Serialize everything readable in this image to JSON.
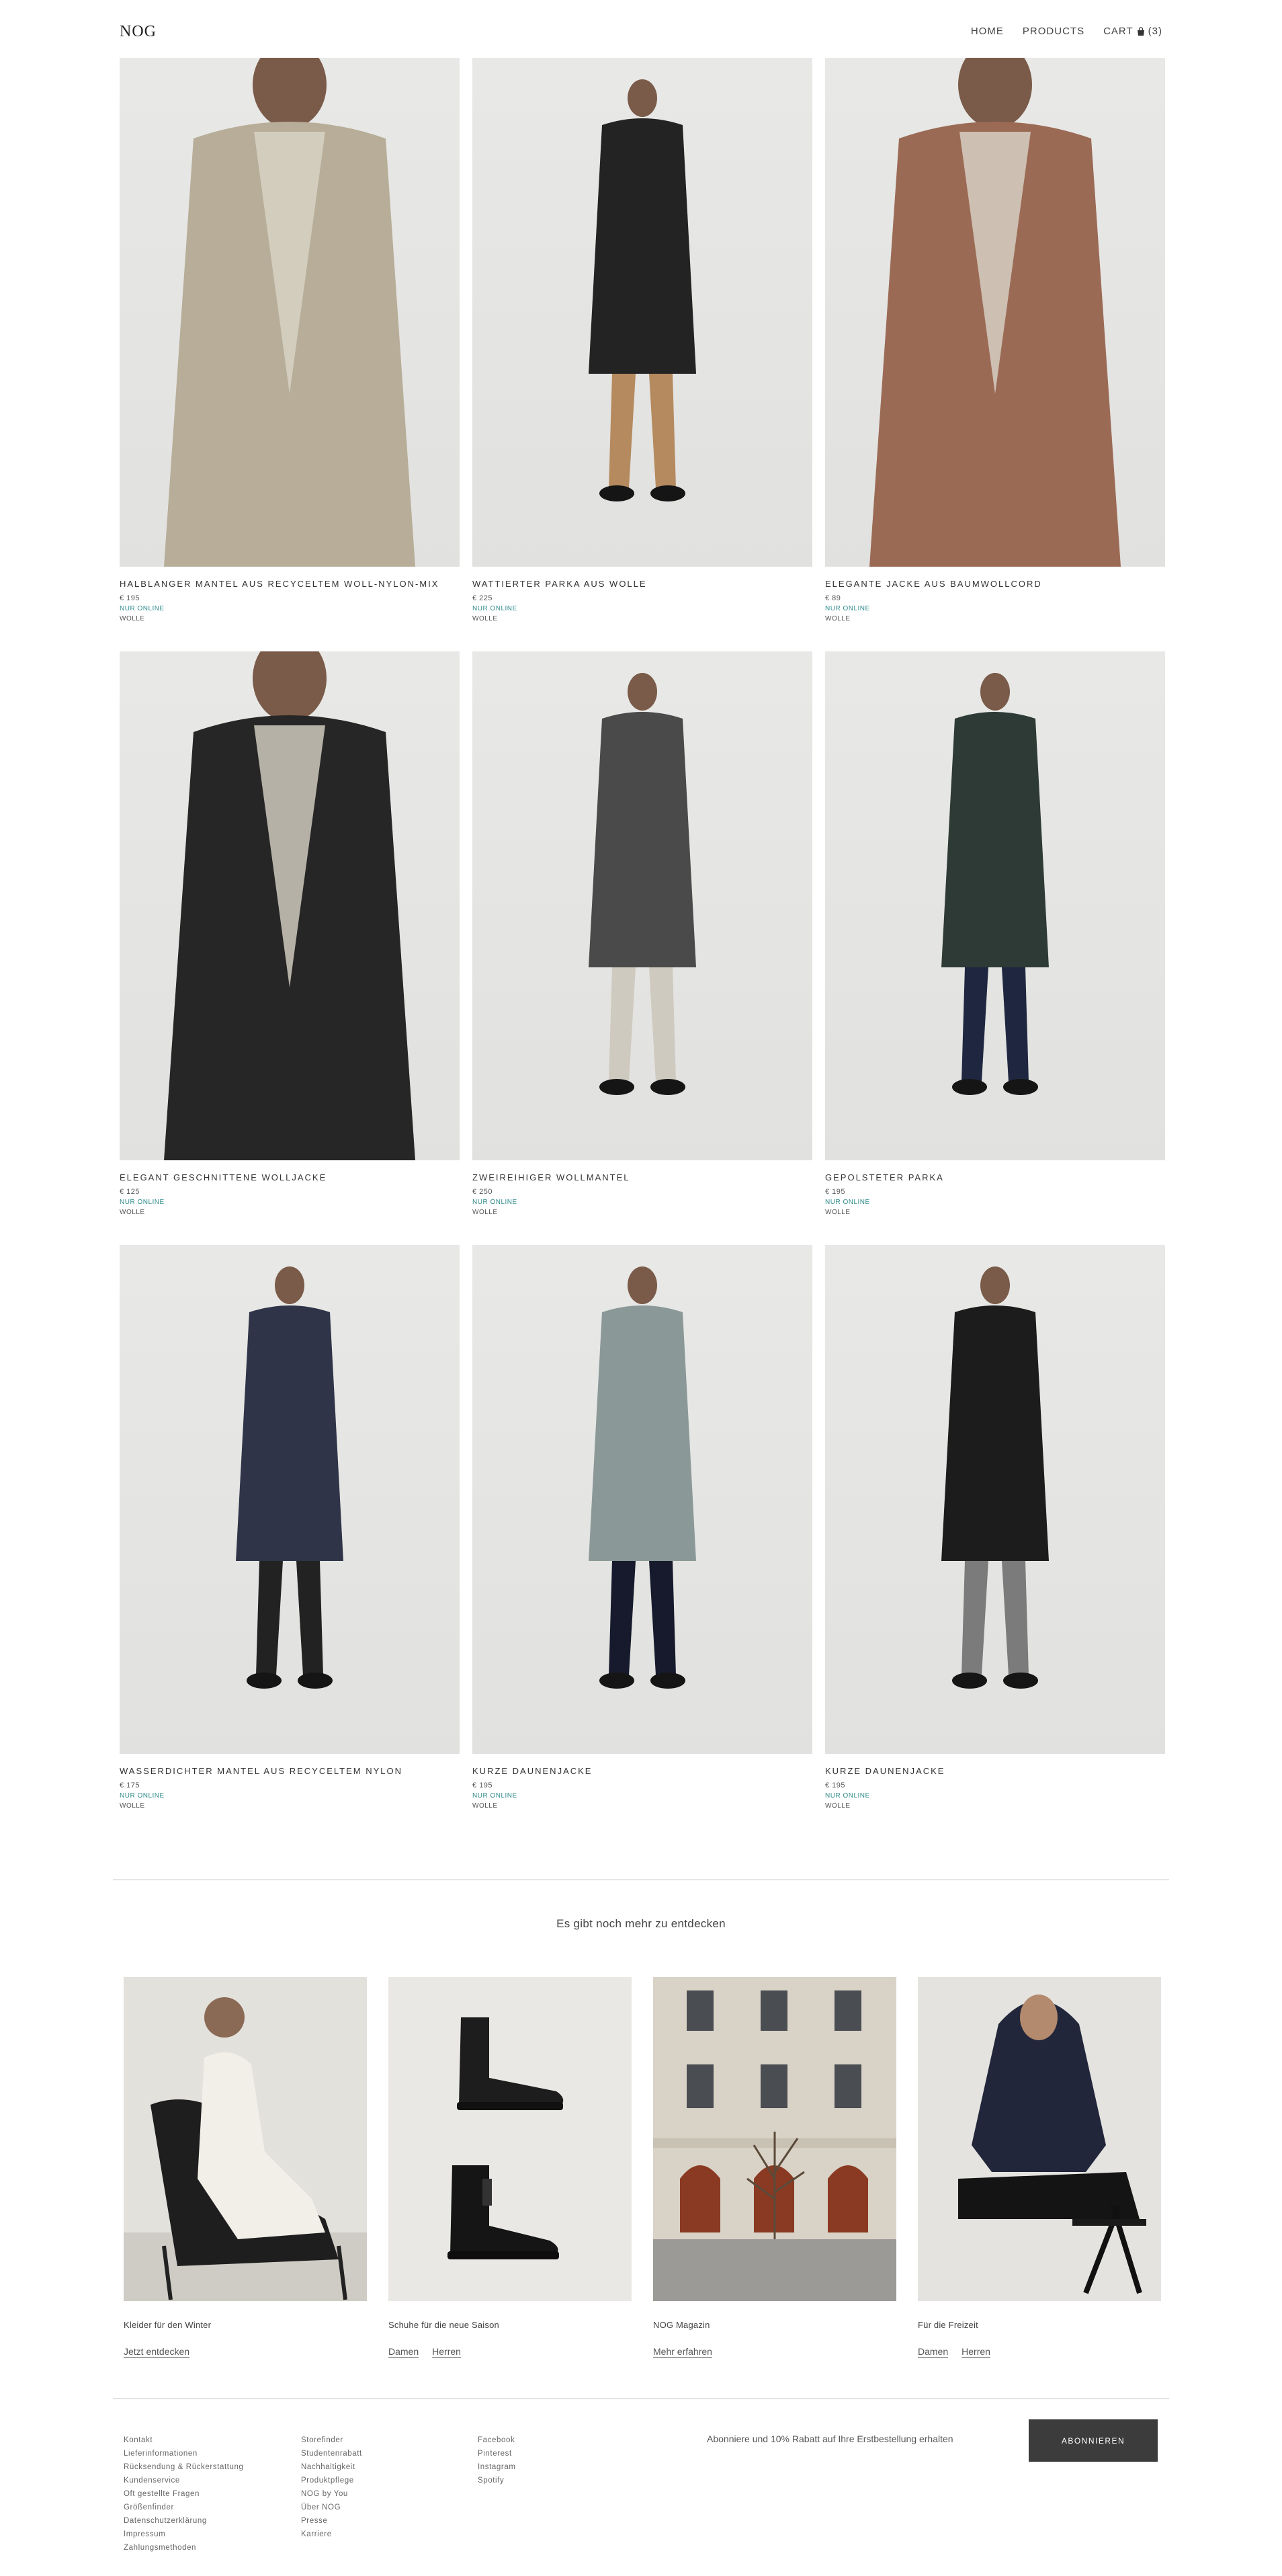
{
  "header": {
    "logo": "NOG",
    "nav": {
      "home": "HOME",
      "products": "PRODUCTS",
      "cart_label": "CART",
      "cart_count": "(3)"
    }
  },
  "products": [
    {
      "name": "HALBLANGER MANTEL AUS RECYCELTEM WOLL-NYLON-MIX",
      "price": "€ 195",
      "badge": "NUR ONLINE",
      "material": "WOLLE",
      "garment_color": "#b7ad98",
      "pants_color": "#b7ad98"
    },
    {
      "name": "WATTIERTER PARKA AUS WOLLE",
      "price": "€ 225",
      "badge": "NUR ONLINE",
      "material": "WOLLE",
      "garment_color": "#232323",
      "pants_color": "#b58a5e"
    },
    {
      "name": "ELEGANTE JACKE AUS BAUMWOLLCORD",
      "price": "€ 89",
      "badge": "NUR ONLINE",
      "material": "WOLLE",
      "garment_color": "#9b6a55",
      "pants_color": "#5b5b44"
    },
    {
      "name": "ELEGANT GESCHNITTENE WOLLJACKE",
      "price": "€ 125",
      "badge": "NUR ONLINE",
      "material": "WOLLE",
      "garment_color": "#262626",
      "pants_color": "#4c4c4c"
    },
    {
      "name": "ZWEIREIHIGER WOLLMANTEL",
      "price": "€ 250",
      "badge": "NUR ONLINE",
      "material": "WOLLE",
      "garment_color": "#4a4a4a",
      "pants_color": "#cfcabf"
    },
    {
      "name": "GEPOLSTETER PARKA",
      "price": "€ 195",
      "badge": "NUR ONLINE",
      "material": "WOLLE",
      "garment_color": "#2d3a35",
      "pants_color": "#1f2740"
    },
    {
      "name": "WASSERDICHTER MANTEL AUS RECYCELTEM NYLON",
      "price": "€ 175",
      "badge": "NUR ONLINE",
      "material": "WOLLE",
      "garment_color": "#2f3448",
      "pants_color": "#222222"
    },
    {
      "name": "KURZE DAUNENJACKE",
      "price": "€ 195",
      "badge": "NUR ONLINE",
      "material": "WOLLE",
      "garment_color": "#8a9998",
      "pants_color": "#161a2c"
    },
    {
      "name": "KURZE DAUNENJACKE",
      "price": "€ 195",
      "badge": "NUR ONLINE",
      "material": "WOLLE",
      "garment_color": "#1c1c1c",
      "pants_color": "#7b7b7b"
    }
  ],
  "discover": {
    "title": "Es gibt noch mehr zu entdecken",
    "cards": [
      {
        "label": "Kleider für den Winter",
        "links": [
          "Jetzt entdecken"
        ]
      },
      {
        "label": "Schuhe für die neue Saison",
        "links": [
          "Damen",
          "Herren"
        ]
      },
      {
        "label": "NOG Magazin",
        "links": [
          "Mehr erfahren"
        ]
      },
      {
        "label": "Für die Freizeit",
        "links": [
          "Damen",
          "Herren"
        ]
      }
    ]
  },
  "footer": {
    "col1": [
      "Kontakt",
      "Lieferinformationen",
      "Rücksendung & Rückerstattung",
      "Kundenservice",
      "Oft gestellte Fragen",
      "Größenfinder",
      "Datenschutzerklärung",
      "Impressum",
      "Zahlungsmethoden"
    ],
    "col2": [
      "Storefinder",
      "Studentenrabatt",
      "Nachhaltigkeit",
      "Produktpflege",
      "NOG by You",
      "Über NOG",
      "Presse",
      "Karriere"
    ],
    "col3": [
      "Facebook",
      "Pinterest",
      "Instagram",
      "Spotify"
    ],
    "newsletter_text": "Abonniere und 10% Rabatt auf Ihre Erstbestellung erhalten",
    "subscribe_label": "ABONNIEREN"
  }
}
